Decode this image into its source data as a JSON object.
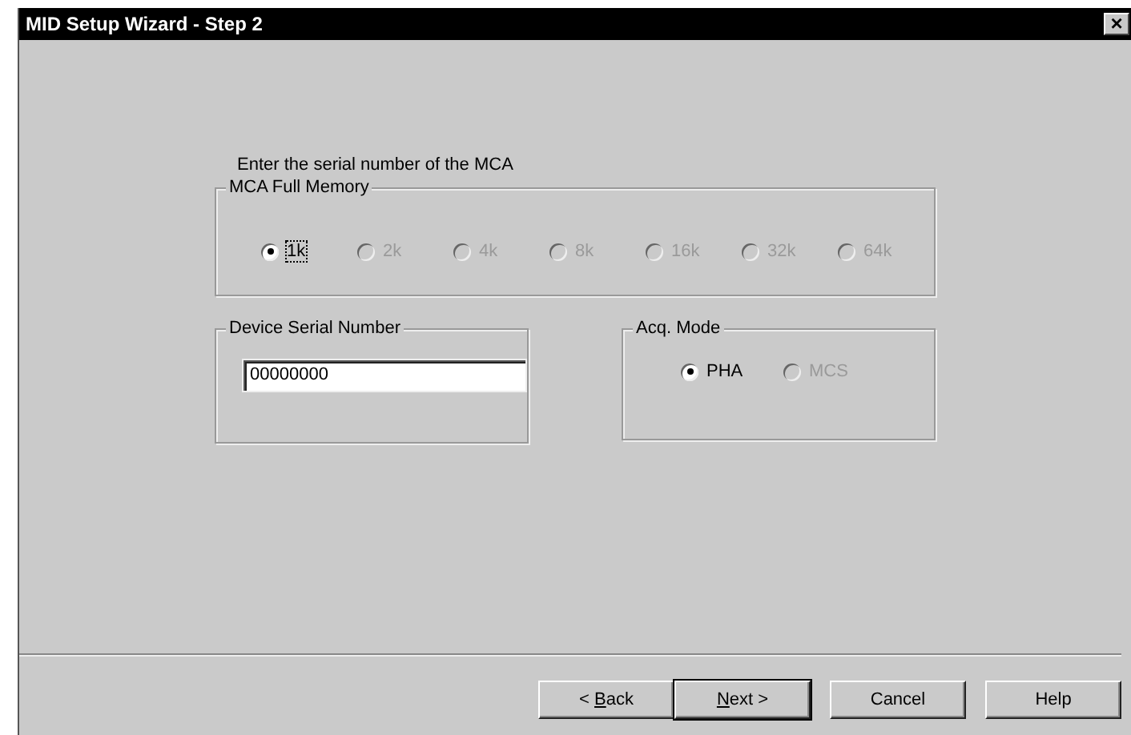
{
  "window": {
    "title": "MID Setup Wizard - Step 2",
    "close": "×"
  },
  "instruction": "Enter the serial number of the MCA",
  "memory_group": {
    "title": "MCA Full Memory",
    "options": [
      {
        "label": "1k",
        "selected": true,
        "disabled": false,
        "focused": true
      },
      {
        "label": "2k",
        "selected": false,
        "disabled": true,
        "focused": false
      },
      {
        "label": "4k",
        "selected": false,
        "disabled": true,
        "focused": false
      },
      {
        "label": "8k",
        "selected": false,
        "disabled": true,
        "focused": false
      },
      {
        "label": "16k",
        "selected": false,
        "disabled": true,
        "focused": false
      },
      {
        "label": "32k",
        "selected": false,
        "disabled": true,
        "focused": false
      },
      {
        "label": "64k",
        "selected": false,
        "disabled": true,
        "focused": false
      }
    ]
  },
  "serial_group": {
    "title": "Device Serial Number",
    "value": "00000000"
  },
  "mode_group": {
    "title": "Acq. Mode",
    "options": [
      {
        "label": "PHA",
        "selected": true,
        "disabled": false,
        "focused": false
      },
      {
        "label": "MCS",
        "selected": false,
        "disabled": true,
        "focused": false
      }
    ]
  },
  "buttons": [
    {
      "parts": [
        {
          "text": "< ",
          "underline": false
        },
        {
          "text": "B",
          "underline": true
        },
        {
          "text": "ack",
          "underline": false
        }
      ],
      "default": false
    },
    {
      "parts": [
        {
          "text": "N",
          "underline": true
        },
        {
          "text": "ext >",
          "underline": false
        }
      ],
      "default": true
    },
    {
      "label": "Cancel",
      "default": false
    },
    {
      "label": "Help",
      "default": false
    }
  ]
}
